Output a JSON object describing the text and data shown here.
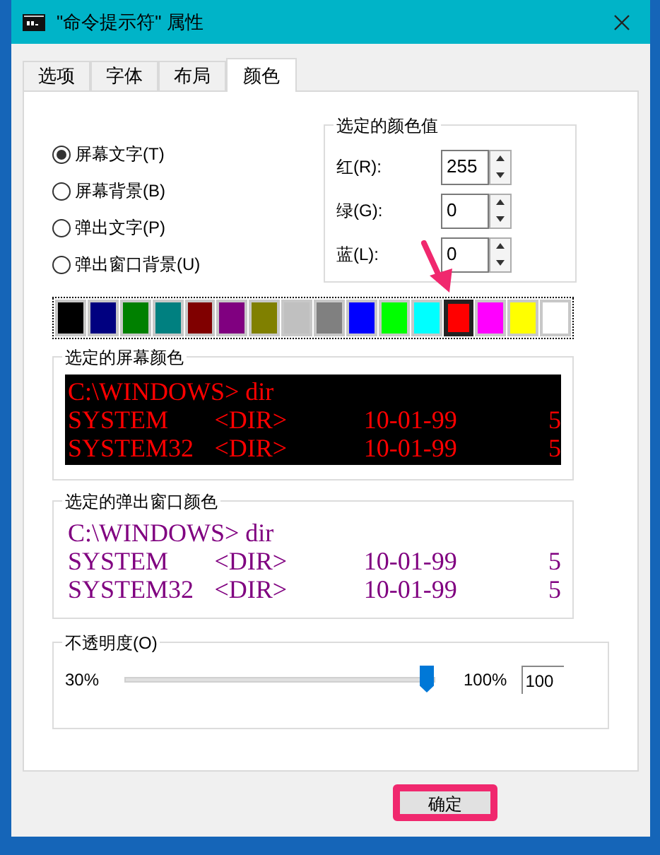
{
  "window": {
    "title": "\"命令提示符\" 属性"
  },
  "tabs": [
    {
      "label": "选项",
      "selected": false
    },
    {
      "label": "字体",
      "selected": false
    },
    {
      "label": "布局",
      "selected": false
    },
    {
      "label": "颜色",
      "selected": true
    }
  ],
  "radios": [
    {
      "label": "屏幕文字(T)",
      "selected": true
    },
    {
      "label": "屏幕背景(B)",
      "selected": false
    },
    {
      "label": "弹出文字(P)",
      "selected": false
    },
    {
      "label": "弹出窗口背景(U)",
      "selected": false
    }
  ],
  "color_values": {
    "title": "选定的颜色值",
    "fields": [
      {
        "label": "红(R):",
        "value": "255"
      },
      {
        "label": "绿(G):",
        "value": "0"
      },
      {
        "label": "蓝(L):",
        "value": "0"
      }
    ]
  },
  "palette": [
    {
      "color": "#000000",
      "selected": false
    },
    {
      "color": "#000080",
      "selected": false
    },
    {
      "color": "#008000",
      "selected": false
    },
    {
      "color": "#008080",
      "selected": false
    },
    {
      "color": "#800000",
      "selected": false
    },
    {
      "color": "#800080",
      "selected": false
    },
    {
      "color": "#808000",
      "selected": false
    },
    {
      "color": "#c0c0c0",
      "selected": false
    },
    {
      "color": "#808080",
      "selected": false
    },
    {
      "color": "#0000ff",
      "selected": false
    },
    {
      "color": "#00ff00",
      "selected": false
    },
    {
      "color": "#00ffff",
      "selected": false
    },
    {
      "color": "#ff0000",
      "selected": true
    },
    {
      "color": "#ff00ff",
      "selected": false
    },
    {
      "color": "#ffff00",
      "selected": false
    },
    {
      "color": "#ffffff",
      "selected": false
    }
  ],
  "previews": [
    {
      "kind": "screen",
      "title": "选定的屏幕颜色",
      "lines": [
        [
          "C:\\WINDOWS> dir"
        ],
        [
          "SYSTEM",
          "<DIR>",
          "10-01-99",
          "5"
        ],
        [
          "SYSTEM32",
          "<DIR>",
          "10-01-99",
          "5"
        ]
      ]
    },
    {
      "kind": "popup",
      "title": "选定的弹出窗口颜色",
      "lines": [
        [
          "C:\\WINDOWS> dir"
        ],
        [
          "SYSTEM",
          "<DIR>",
          "10-01-99",
          "5"
        ],
        [
          "SYSTEM32",
          "<DIR>",
          "10-01-99",
          "5"
        ]
      ]
    }
  ],
  "opacity": {
    "title": "不透明度(O)",
    "min_label": "30%",
    "max_label": "100%",
    "level": 1,
    "value": "100"
  },
  "buttons": [
    {
      "label": "确定",
      "highlighted": true
    }
  ]
}
